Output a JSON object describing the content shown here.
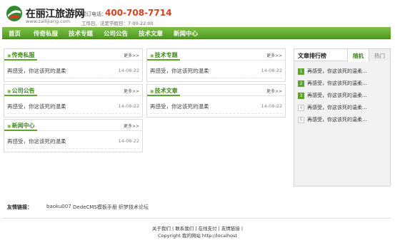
{
  "header": {
    "logo_name": "在丽江旅游网",
    "logo_url": "www.zailijiang.com",
    "hotline_label": "预订电话：",
    "hotline_number": "400-708-7714",
    "hours": "工作日、法定节假日：7:00-22:00"
  },
  "nav": {
    "items": [
      {
        "label": "首页"
      },
      {
        "label": "传奇私服"
      },
      {
        "label": "技术专题"
      },
      {
        "label": "公司公告"
      },
      {
        "label": "技术文章"
      },
      {
        "label": "新闻中心"
      }
    ]
  },
  "boxes": [
    {
      "title": "传奇私服",
      "more": "更多>>",
      "item": "再感受，你这该死的温柔",
      "date": "14-08-22"
    },
    {
      "title": "技术专题",
      "more": "更多>>",
      "item": "再感受，你这该死的温柔",
      "date": "14-08-22"
    },
    {
      "title": "公司公告",
      "more": "更多>>",
      "item": "再感受，你这该死的温柔",
      "date": "14-08-22"
    },
    {
      "title": "技术文章",
      "more": "更多>>",
      "item": "再感受，你这该死的温柔",
      "date": "14-08-22"
    },
    {
      "title": "新闻中心",
      "more": "更多>>",
      "item": "再感受，你这该死的温柔",
      "date": "14-08-22"
    }
  ],
  "sidebar": {
    "title": "文章排行榜",
    "tab_random": "随机",
    "tab_hot": "热门",
    "items": [
      {
        "num": "1",
        "text": "再感受，你这该死的温柔..."
      },
      {
        "num": "2",
        "text": "再感受，你这该死的温柔..."
      },
      {
        "num": "3",
        "text": "再感受，你这该死的温柔..."
      },
      {
        "num": "4",
        "text": "再感受，你这该死的温柔..."
      },
      {
        "num": "5",
        "text": "再感受，你这该死的温柔..."
      }
    ]
  },
  "friend_links": {
    "label": "友情链接：",
    "links": [
      "baoku007",
      "DedeCMS模板手册",
      "织梦技术论坛"
    ]
  },
  "footer": {
    "links_line": "关于我们 | 联系我们 | 在线支付 | 友情链接 |",
    "copyright": "Copyright 我的网站 http://localhost"
  },
  "colors": {
    "accent_green": "#5da52b",
    "hotline_red": "#d8401b"
  }
}
